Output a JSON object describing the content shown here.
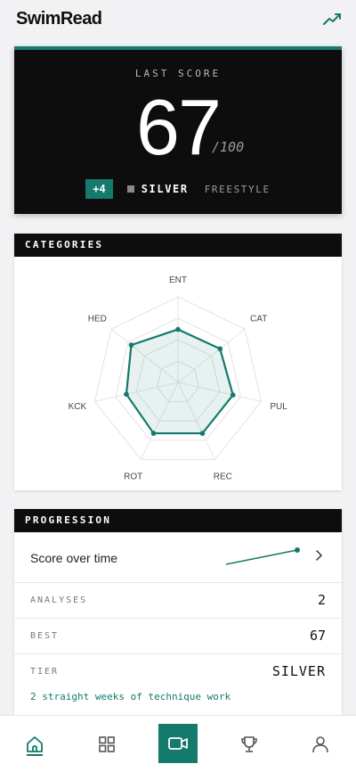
{
  "app": {
    "title": "SwimRead"
  },
  "score": {
    "eyebrow": "LAST SCORE",
    "value": "67",
    "max": "/100",
    "delta": "+4",
    "tier": "SILVER",
    "stroke": "FREESTYLE"
  },
  "categories": {
    "heading": "CATEGORIES",
    "axes": [
      "ENT",
      "CAT",
      "PUL",
      "REC",
      "ROT",
      "KCK",
      "HED"
    ],
    "levels": [
      0.62,
      0.63,
      0.66,
      0.66,
      0.66,
      0.62,
      0.7
    ]
  },
  "progression": {
    "heading": "PROGRESSION",
    "score_over_time_label": "Score over time",
    "score_history": [
      63,
      67
    ],
    "analyses_label": "ANALYSES",
    "analyses_value": "2",
    "best_label": "BEST",
    "best_value": "67",
    "tier_label": "TIER",
    "tier_value": "SILVER",
    "streak_note": "2 straight weeks of technique work"
  },
  "nav": {
    "items": [
      "home-icon",
      "grid-icon",
      "video-camera-icon",
      "trophy-icon",
      "profile-icon"
    ],
    "active": "home"
  },
  "colors": {
    "accent": "#137a6c",
    "dark": "#0d0d0d",
    "silver": "#8a8a8a"
  }
}
